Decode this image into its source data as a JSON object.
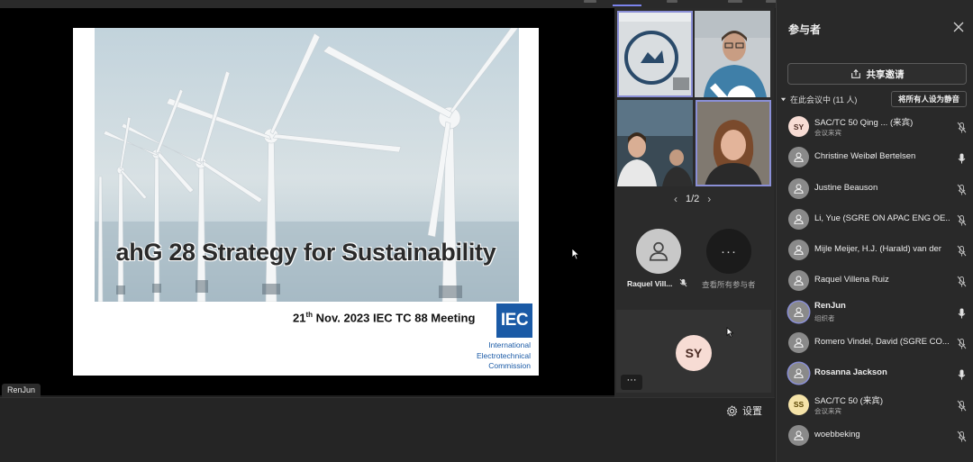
{
  "slide": {
    "title": "ahG 28 Strategy for Sustainability",
    "meeting_day": "21",
    "meeting_suffix": "th",
    "meeting_rest": " Nov. 2023 IEC TC 88 Meeting",
    "logo_text": "IEC",
    "org_line1": "International",
    "org_line2": "Electrotechnical",
    "org_line3": "Commission"
  },
  "presenter_label": "RenJun",
  "bottombar": {
    "settings_label": "设置",
    "settings_icon": "gear-icon"
  },
  "video_panel": {
    "pager": "1/2",
    "tile_person_name": "Raquel Vill...",
    "more_label": "查看所有参与者",
    "more_glyph": "···",
    "self_initials": "SY",
    "dots_glyph": "···"
  },
  "panel": {
    "title": "参与者",
    "share_label": "共享邀请",
    "in_meeting_label": "在此会议中 (11 人)",
    "mute_all_label": "将所有人设为静音",
    "participants": [
      {
        "name": "SAC/TC 50 Qing ... (来宾)",
        "sub": "会议来宾",
        "initials": "SY",
        "mic": "muted"
      },
      {
        "name": "Christine Weibøl Bertelsen",
        "sub": "",
        "initials": "",
        "mic": "on"
      },
      {
        "name": "Justine Beauson",
        "sub": "",
        "initials": "",
        "mic": "muted"
      },
      {
        "name": "Li, Yue (SGRE ON APAC ENG OE...",
        "sub": "",
        "initials": "",
        "mic": "muted"
      },
      {
        "name": "Mijle Meijer, H.J. (Harald) van der",
        "sub": "",
        "initials": "",
        "mic": "muted"
      },
      {
        "name": "Raquel Villena Ruiz",
        "sub": "",
        "initials": "",
        "mic": "muted"
      },
      {
        "name": "RenJun",
        "sub": "组织者",
        "initials": "",
        "mic": "on"
      },
      {
        "name": "Romero Vindel, David (SGRE CO...",
        "sub": "",
        "initials": "",
        "mic": "muted"
      },
      {
        "name": "Rosanna Jackson",
        "sub": "",
        "initials": "",
        "mic": "on"
      },
      {
        "name": "SAC/TC 50 (来宾)",
        "sub": "会议来宾",
        "initials": "SS",
        "mic": "muted"
      },
      {
        "name": "woebbeking",
        "sub": "",
        "initials": "",
        "mic": "muted"
      }
    ]
  },
  "colors": {
    "accent": "#7b83eb",
    "iec_blue": "#1a5aa6",
    "panel_bg": "#292929"
  }
}
